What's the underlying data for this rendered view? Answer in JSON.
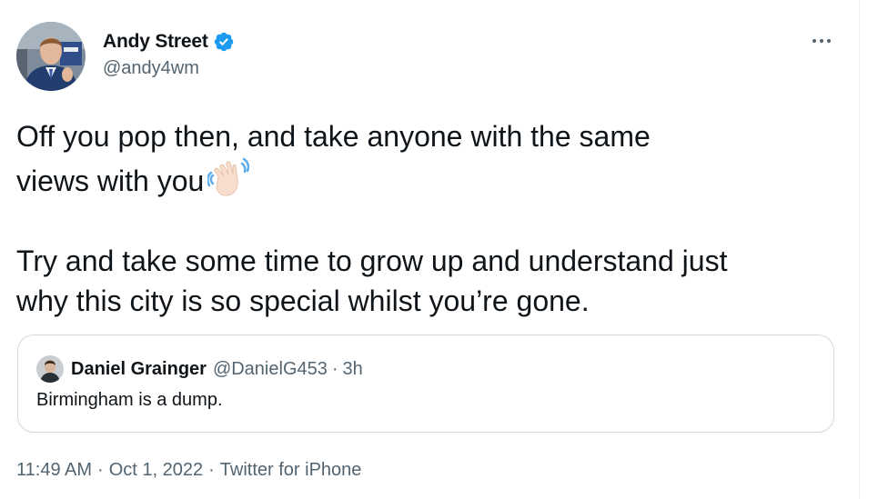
{
  "author": {
    "display_name": "Andy Street",
    "handle": "@andy4wm",
    "avatar_icon": "profile-photo",
    "verified_icon": "verified-badge-icon",
    "verified_color": "#1d9bf0"
  },
  "more_icon": "more-options-icon",
  "tweet": {
    "line1": "Off you pop then, and take anyone with the same",
    "line2": "views with you",
    "emoji": "waving-hand-light-skin-tone",
    "line3": "Try and take some time to grow up and understand just",
    "line4": "why this city is so special whilst you’re gone."
  },
  "quoted_tweet": {
    "display_name": "Daniel Grainger",
    "handle": "@DanielG453",
    "separator": "·",
    "time": "3h",
    "text": "Birmingham is a dump."
  },
  "meta": {
    "time": "11:49 AM",
    "separator": "·",
    "date": "Oct 1, 2022",
    "source": "Twitter for iPhone"
  },
  "colors": {
    "text_primary": "#0f1419",
    "text_secondary": "#536471",
    "border": "#cfd9de",
    "accent": "#1d9bf0"
  }
}
